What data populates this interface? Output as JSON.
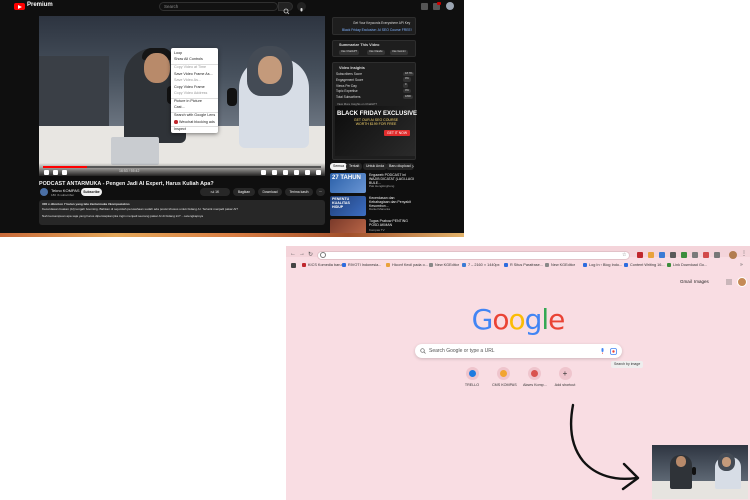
{
  "youtube": {
    "brand": "Premium",
    "search_placeholder": "Search",
    "video_time": "16:53 / 55:42",
    "context_menu": [
      {
        "label": "Loop",
        "disabled": false
      },
      {
        "label": "Show All Controls",
        "disabled": false
      },
      {
        "label": "Copy Video at Time",
        "disabled": true
      },
      {
        "label": "Save Video Frame As...",
        "disabled": false
      },
      {
        "label": "Save Video As...",
        "disabled": true
      },
      {
        "label": "Copy Video Frame",
        "disabled": false
      },
      {
        "label": "Copy Video Address",
        "disabled": true
      },
      {
        "label": "Picture in Picture",
        "disabled": false
      },
      {
        "label": "Cast...",
        "disabled": false
      },
      {
        "label": "Search with Google Lens",
        "disabled": false
      },
      {
        "label": "Wecchat blocking ads",
        "disabled": false
      },
      {
        "label": "Inspect",
        "disabled": false
      }
    ],
    "title": "PODCAST ANTARMUKA - Pengen Jadi AI Expert, Harus Kuliah Apa?",
    "channel": "Tekno KOMPAS",
    "subscribers": "180 rb subscriber",
    "subscribe_label": "Subscribe",
    "actions": {
      "likes": "1K",
      "share": "Bagikan",
      "download": "Download",
      "thanks": "Terima kasih"
    },
    "description": {
      "meta": "300 x ditonton 7 bulan yang lalu #antarmuka #kompastekno",
      "line1": "Kecerdasan buatan (AI) tengah booming. Bahkan di sejumlah perusahaan sudah ada posisi khusus untuk bidang AI. Tertarik menjadi pakar AI?",
      "line2": "Nah kemampuan apa saja yang harus dipersiapkan jika ingin menjadi seorang pakar AI di bidang ini? ...selengkapnya"
    },
    "sidebar": {
      "ext_banner": "Get Your Keywords Everywhere API Key",
      "ext_promo": "Black Friday Exclusive: AI SEO Course FREE!",
      "summarize_title": "Summarize This Video",
      "summarize_buttons": [
        "Use ChatGPT",
        "Use Claude",
        "Use Gemini"
      ],
      "insights_title": "Video Insights",
      "insights": [
        {
          "label": "Subscribers Score",
          "value": "18.7%"
        },
        {
          "label": "Engagement Score",
          "value": "0%"
        },
        {
          "label": "Views Per Day",
          "value": "0"
        },
        {
          "label": "Topic Expertise",
          "value": "0%"
        },
        {
          "label": "Total Subscribers",
          "value": "180K"
        }
      ],
      "insights_link": "View More Insights on ChatGPT",
      "ad": {
        "title": "BLACK FRIDAY EXCLUSIVE",
        "sub": "GET OUR AI SEO COURSE WORTH $199 FOR FREE",
        "button": "GET IT NOW"
      },
      "chips": [
        "Semua",
        "Terkait",
        "Untuk Anda",
        "Baru diupload"
      ],
      "recommendations": [
        {
          "title": "Engaweb PODCAST ini WAJIB DICATAT (LAGI-LAGI BULE...",
          "meta": "Pak Hengkinghung",
          "thumb_text": "27 TAHUN"
        },
        {
          "title": "Kecerdasan dan Kebahagiaan dan Penyakit Kesombon...",
          "meta": "Daniel Mananta",
          "thumb_text": "PENENTU KUALITAS HIDUP"
        },
        {
          "title": "Tugas Prabow PENTING POSD AKMAN",
          "meta": "Kompas TV",
          "thumb_text": ""
        }
      ]
    }
  },
  "chrome": {
    "tabs_placeholder": "",
    "bookmarks": [
      "KICS Komedia baru",
      "RIVOTI Indonesia...",
      "Hiconf Kecil pada o...",
      "New KGEditor",
      "7 – 2160 × 1440px",
      "R Situs Parafrase...",
      "New KGEditor",
      "Log In ‹ Blog Indo...",
      "Content Writing 16...",
      "Link Download Go..."
    ],
    "top_links": [
      "Gmail",
      "Images"
    ],
    "logo": [
      {
        "ch": "G",
        "color": "#4285F4"
      },
      {
        "ch": "o",
        "color": "#EA4335"
      },
      {
        "ch": "o",
        "color": "#FBBC05"
      },
      {
        "ch": "g",
        "color": "#4285F4"
      },
      {
        "ch": "l",
        "color": "#34A853"
      },
      {
        "ch": "e",
        "color": "#EA4335"
      }
    ],
    "search_placeholder": "Search Google or type a URL",
    "tooltip": "Search by image",
    "shortcuts": [
      {
        "label": "TRELLO",
        "color": "#1f7be0"
      },
      {
        "label": "CMS KOMPAS",
        "color": "#f2a531"
      },
      {
        "label": "Akses Komp...",
        "color": "#d9534f"
      },
      {
        "label": "Add shortcut",
        "color": ""
      }
    ]
  },
  "colors": {
    "chrome_bg": "#f9dde3",
    "youtube_bg": "#0f0f0f",
    "accent_red": "#ff0000"
  }
}
